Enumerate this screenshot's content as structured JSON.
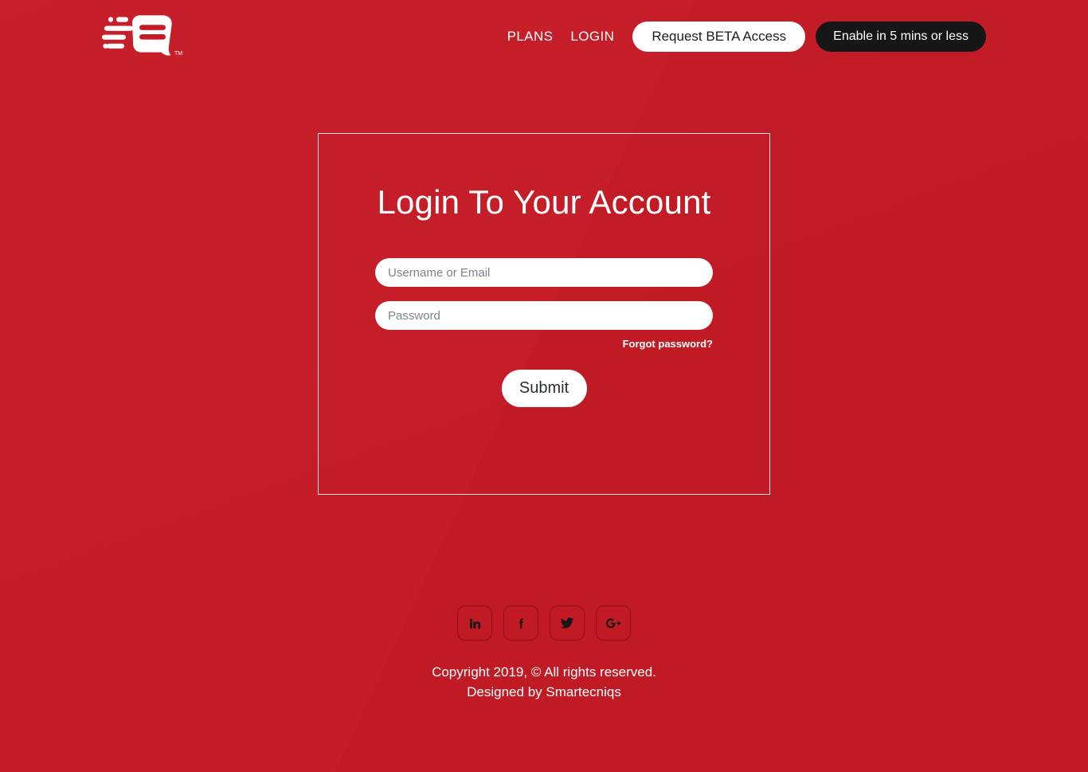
{
  "theme": {
    "background_red": "#c51a25",
    "accent_black": "#161616",
    "card_border": "#f2e2e2",
    "placeholder_gray": "#7c838c"
  },
  "header": {
    "logo_name": "smartecniqs-logo",
    "logo_trademark": "TM",
    "nav_links": [
      {
        "label": "PLANS",
        "name": "nav-link-plans"
      },
      {
        "label": "LOGIN",
        "name": "nav-link-login"
      }
    ],
    "cta_beta": "Request BETA Access",
    "cta_enable": "Enable in 5 mins or less"
  },
  "login_card": {
    "title": "Login To Your Account",
    "username": {
      "value": "",
      "placeholder": "Username or Email"
    },
    "password": {
      "value": "",
      "placeholder": "Password"
    },
    "forgot_password": "Forgot password?",
    "submit_label": "Submit"
  },
  "footer": {
    "socials": [
      {
        "name": "linkedin-icon",
        "label": "in"
      },
      {
        "name": "facebook-icon",
        "label": "f"
      },
      {
        "name": "twitter-icon",
        "label": "twitter"
      },
      {
        "name": "google-plus-icon",
        "label": "G+"
      }
    ],
    "copyright_line1": "Copyright 2019, © All rights reserved.",
    "copyright_line2": "Designed by Smartecniqs"
  }
}
